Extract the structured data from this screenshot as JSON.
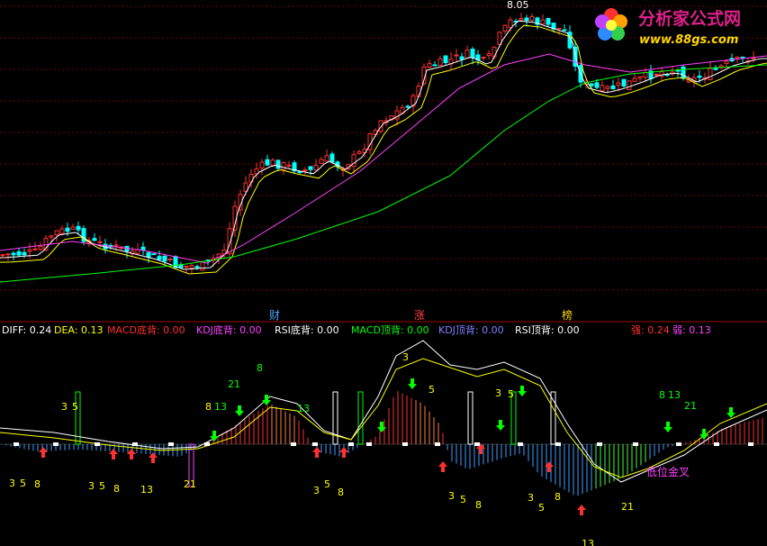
{
  "watermark": {
    "brand": "分析家公式网",
    "url": "www.88gs.com",
    "brand_color": "#e0218a",
    "url_color": "#ffd700"
  },
  "price_panel": {
    "high_label": "8.05",
    "markers": [
      {
        "label": "财",
        "color": "#4aa3ff"
      },
      {
        "label": "涨",
        "color": "#ff4040"
      },
      {
        "label": "榜",
        "color": "#ffd700"
      }
    ]
  },
  "indicator_header": [
    {
      "label": "DIFF: 0.24",
      "color": "#ffffff"
    },
    {
      "label": "DEA: 0.13",
      "color": "#ffff00"
    },
    {
      "label": "MACD底背: 0.00",
      "color": "#ff3030"
    },
    {
      "label": "KDJ底背: 0.00",
      "color": "#ff40ff"
    },
    {
      "label": "RSI底背: 0.00",
      "color": "#ffffff"
    },
    {
      "label": "MACD顶背: 0.00",
      "color": "#00ff00"
    },
    {
      "label": "KDJ顶背: 0.00",
      "color": "#8080ff"
    },
    {
      "label": "RSI顶背: 0.00",
      "color": "#ffffff"
    },
    {
      "label": "强: 0.24",
      "color": "#ff3030"
    },
    {
      "label": "弱: 0.13",
      "color": "#ff40ff"
    }
  ],
  "annotation": {
    "label": "低位金叉",
    "color": "#ff40ff"
  },
  "fib_labels": {
    "upper": [
      "3",
      "5",
      "8",
      "13",
      "21",
      "8",
      "13",
      "3",
      "5",
      "3",
      "5",
      "8",
      "13",
      "21"
    ],
    "lower": [
      "3",
      "5",
      "8",
      "3",
      "5",
      "8",
      "13",
      "21",
      "3",
      "5",
      "8",
      "3",
      "5",
      "8",
      "3",
      "5",
      "8",
      "13",
      "21",
      "13"
    ]
  },
  "chart_data": {
    "type": "candlestick",
    "colors": {
      "up": "#ff3030",
      "down": "#00ffff",
      "ma5": "#ffffff",
      "ma10": "#ffff00",
      "ma20": "#ff40ff",
      "ma60": "#00ff00"
    },
    "price_max": 8.05,
    "macd": {
      "diff": 0.24,
      "dea": 0.13
    }
  }
}
